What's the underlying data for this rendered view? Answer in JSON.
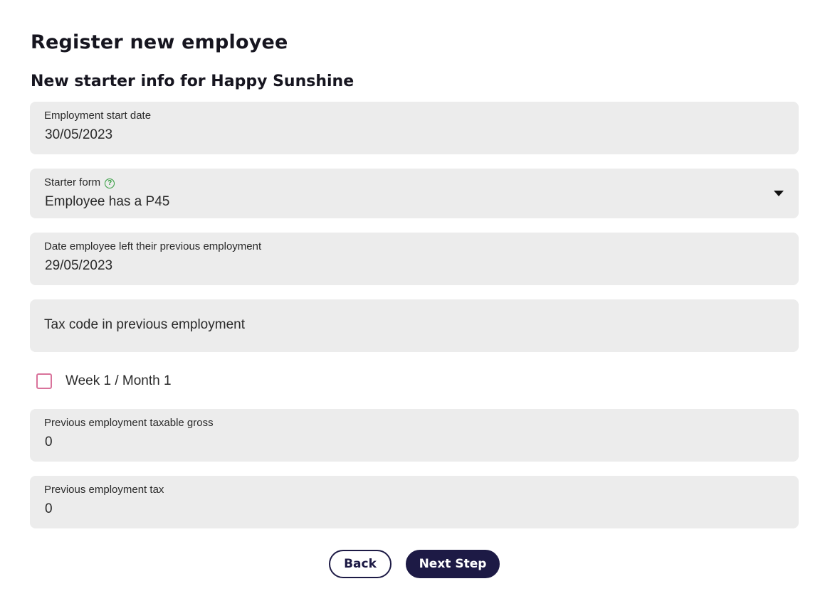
{
  "page": {
    "title": "Register new employee",
    "section_title": "New starter info for Happy Sunshine"
  },
  "fields": {
    "start_date": {
      "label": "Employment start date",
      "value": "30/05/2023"
    },
    "starter_form": {
      "label": "Starter form",
      "value": "Employee has a P45",
      "help_icon": "?"
    },
    "left_date": {
      "label": "Date employee left their previous employment",
      "value": "29/05/2023"
    },
    "tax_code": {
      "placeholder": "Tax code in previous employment"
    },
    "taxable_gross": {
      "label": "Previous employment taxable gross",
      "value": "0"
    },
    "tax": {
      "label": "Previous employment tax",
      "value": "0"
    }
  },
  "week1_month1": {
    "label": "Week 1 / Month 1",
    "checked": false
  },
  "buttons": {
    "back": "Back",
    "next": "Next Step"
  },
  "colors": {
    "field_bg": "#ececec",
    "primary": "#1d1a45",
    "help_green": "#2e9a3a",
    "checkbox_border": "#d9739b"
  },
  "icons": {
    "help": "help-circle-icon",
    "dropdown": "caret-down-icon"
  }
}
